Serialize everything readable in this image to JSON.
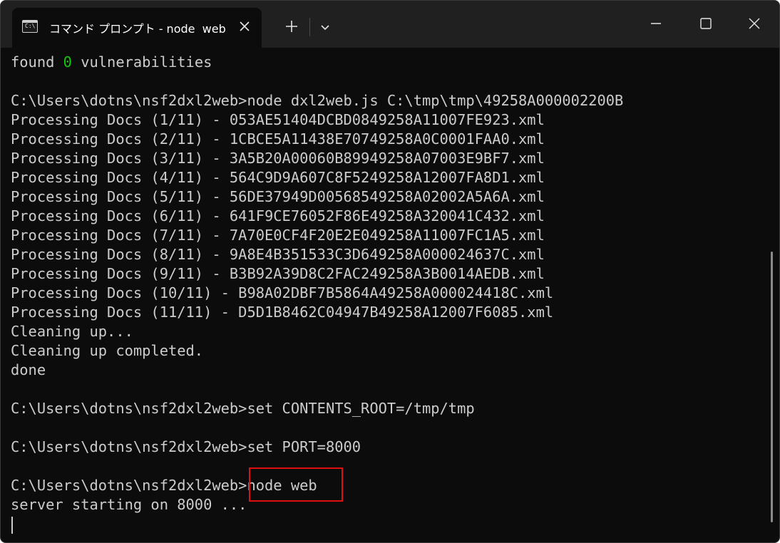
{
  "window": {
    "tab_title": "コマンド プロンプト - node  web",
    "tab_icon": "command-prompt-icon",
    "tab_icon_text": "C:\\",
    "new_tab_icon": "plus-icon",
    "dropdown_icon": "chevron-down-icon",
    "controls": [
      "minimize-icon",
      "maximize-icon",
      "close-icon"
    ]
  },
  "terminal": {
    "found_prefix": "found ",
    "found_count": "0",
    "found_suffix": " vulnerabilities",
    "lines": [
      "C:\\Users\\dotns\\nsf2dxl2web>node dxl2web.js C:\\tmp\\tmp\\49258A000002200B",
      "Processing Docs (1/11) - 053AE51404DCBD0849258A11007FE923.xml",
      "Processing Docs (2/11) - 1CBCE5A11438E70749258A0C0001FAA0.xml",
      "Processing Docs (3/11) - 3A5B20A00060B89949258A07003E9BF7.xml",
      "Processing Docs (4/11) - 564C9D9A607C8F5249258A12007FA8D1.xml",
      "Processing Docs (5/11) - 56DE37949D00568549258A02002A5A6A.xml",
      "Processing Docs (6/11) - 641F9CE76052F86E49258A320041C432.xml",
      "Processing Docs (7/11) - 7A70E0CF4F20E2E049258A11007FC1A5.xml",
      "Processing Docs (8/11) - 9A8E4B351533C3D649258A000024637C.xml",
      "Processing Docs (9/11) - B3B92A39D8C2FAC249258A3B0014AEDB.xml",
      "Processing Docs (10/11) - B98A02DBF7B5864A49258A000024418C.xml",
      "Processing Docs (11/11) - D5D1B8462C04947B49258A12007F6085.xml",
      "Cleaning up...",
      "Cleaning up completed.",
      "done",
      "",
      "C:\\Users\\dotns\\nsf2dxl2web>set CONTENTS_ROOT=/tmp/tmp",
      "",
      "C:\\Users\\dotns\\nsf2dxl2web>set PORT=8000",
      "",
      "C:\\Users\\dotns\\nsf2dxl2web>node web",
      "server starting on 8000 ..."
    ]
  },
  "colors": {
    "background": "#0c0c0c",
    "text": "#cccccc",
    "green": "#16c60c",
    "highlight": "#e01010"
  }
}
